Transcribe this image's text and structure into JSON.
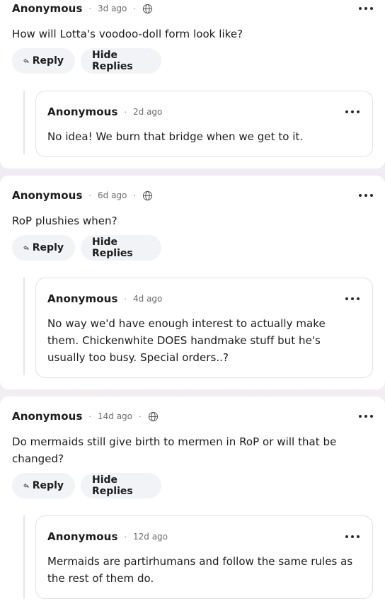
{
  "ui": {
    "reply_label": "Reply",
    "hide_replies_label": "Hide Replies",
    "separator": "·"
  },
  "comments": [
    {
      "author": "Anonymous",
      "time": "3d ago",
      "text": "How will Lotta's voodoo-doll form look like?",
      "reply": {
        "author": "Anonymous",
        "time": "2d ago",
        "text": "No idea! We burn that bridge when we get to it."
      }
    },
    {
      "author": "Anonymous",
      "time": "6d ago",
      "text": "RoP plushies when?",
      "reply": {
        "author": "Anonymous",
        "time": "4d ago",
        "text": "No way we'd have enough interest to actually make them. Chickenwhite DOES handmake stuff but he's usually too busy. Special orders..?"
      }
    },
    {
      "author": "Anonymous",
      "time": "14d ago",
      "text": "Do mermaids still give birth to mermen in RoP or will that be changed?",
      "reply": {
        "author": "Anonymous",
        "time": "12d ago",
        "text": "Mermaids are partirhumans and follow the same rules as the rest of them do."
      }
    }
  ]
}
